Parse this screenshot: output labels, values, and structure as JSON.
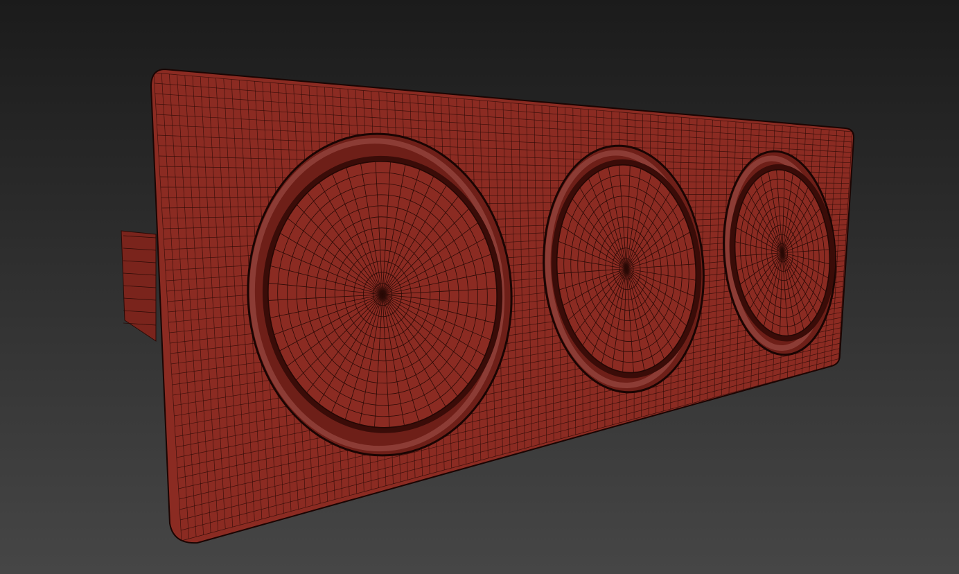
{
  "scene": {
    "background_top": "#1b1b1b",
    "background_bottom": "#464646",
    "mesh_color": "#8b2b22",
    "mesh_shade": "#6e1f18",
    "wire_color": "#2a0a06",
    "rim_highlight": "#a0504a"
  },
  "gauges": [
    {
      "name": "large-gauge",
      "spokes": 48,
      "rings": 12
    },
    {
      "name": "medium-gauge",
      "spokes": 40,
      "rings": 10
    },
    {
      "name": "small-gauge",
      "spokes": 36,
      "rings": 9
    }
  ]
}
